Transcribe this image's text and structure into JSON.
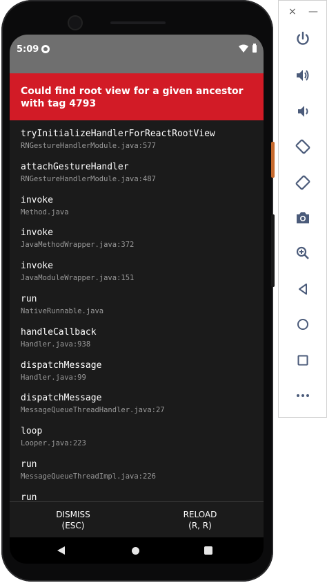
{
  "status_bar": {
    "time": "5:09"
  },
  "redbox": {
    "title": "Could find root view for a given ancestor with tag 4793"
  },
  "stack": [
    {
      "method": "tryInitializeHandlerForReactRootView",
      "file": "RNGestureHandlerModule.java:577"
    },
    {
      "method": "attachGestureHandler",
      "file": "RNGestureHandlerModule.java:487"
    },
    {
      "method": "invoke",
      "file": "Method.java"
    },
    {
      "method": "invoke",
      "file": "JavaMethodWrapper.java:372"
    },
    {
      "method": "invoke",
      "file": "JavaModuleWrapper.java:151"
    },
    {
      "method": "run",
      "file": "NativeRunnable.java"
    },
    {
      "method": "handleCallback",
      "file": "Handler.java:938"
    },
    {
      "method": "dispatchMessage",
      "file": "Handler.java:99"
    },
    {
      "method": "dispatchMessage",
      "file": "MessageQueueThreadHandler.java:27"
    },
    {
      "method": "loop",
      "file": "Looper.java:223"
    },
    {
      "method": "run",
      "file": "MessageQueueThreadImpl.java:226"
    },
    {
      "method": "run",
      "file": ""
    }
  ],
  "footer": {
    "dismiss_label": "DISMISS",
    "dismiss_shortcut": "(ESC)",
    "reload_label": "RELOAD",
    "reload_shortcut": "(R, R)"
  },
  "toolbar": {
    "close_glyph": "×",
    "minimize_glyph": "—",
    "items": [
      "power-icon",
      "volume-up-icon",
      "volume-down-icon",
      "rotate-left-icon",
      "rotate-right-icon",
      "camera-icon",
      "zoom-icon",
      "back-icon",
      "home-icon",
      "overview-icon",
      "more-icon"
    ]
  },
  "colors": {
    "redbox": "#d21b26",
    "stack_bg": "#1b1b1b",
    "status_bar": "#6f6f6f",
    "toolbar_icon": "#4b5b7a"
  }
}
